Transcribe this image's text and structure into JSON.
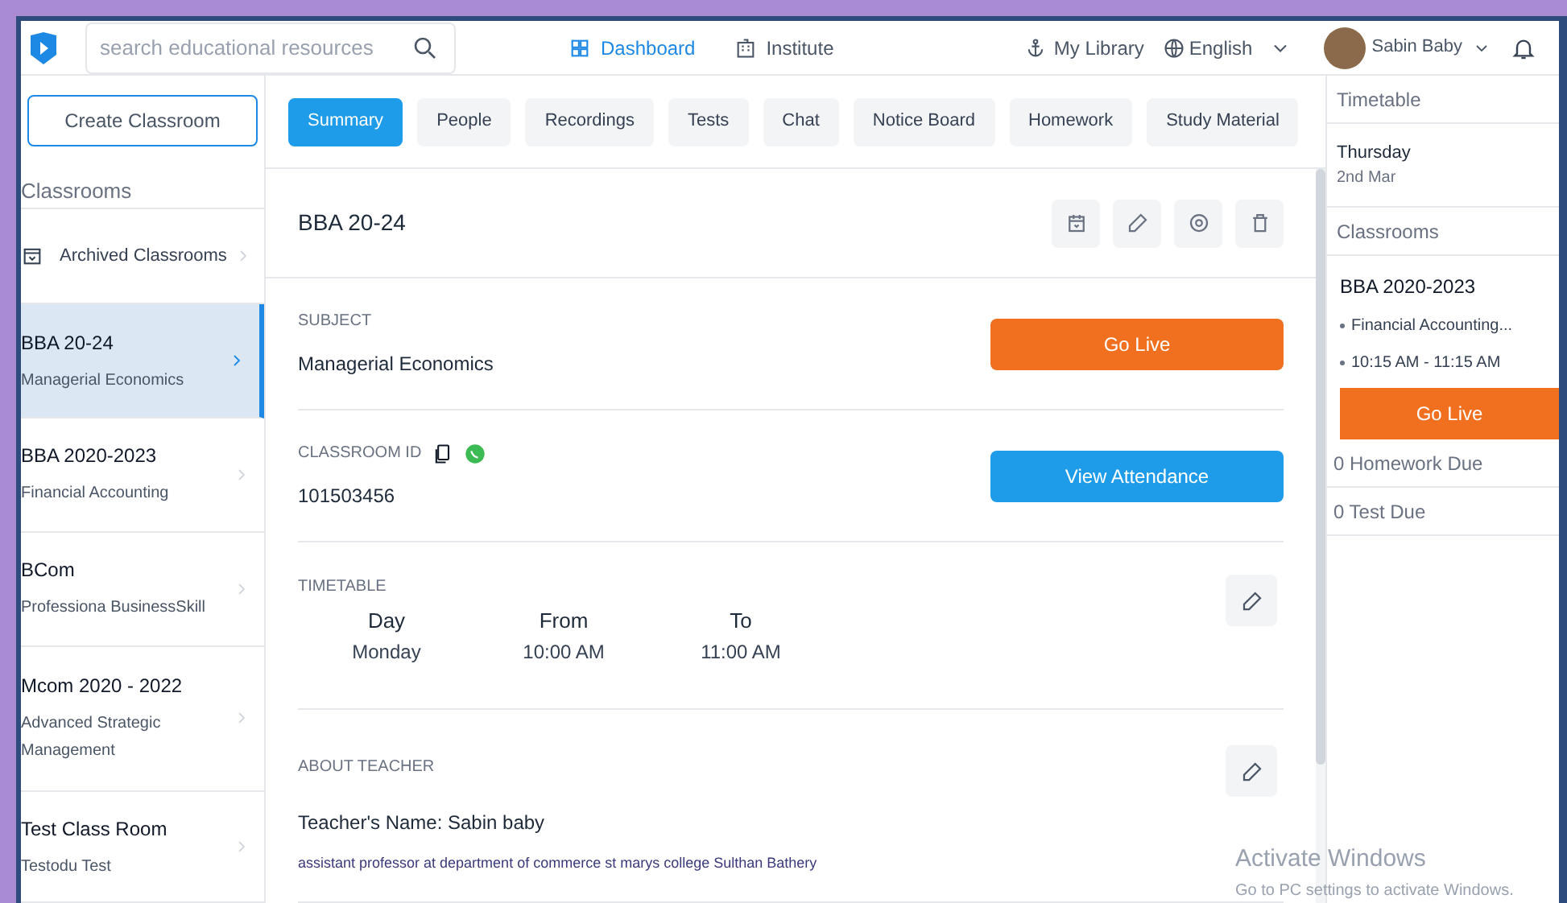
{
  "header": {
    "search": {
      "placeholder": "search educational resources"
    },
    "nav": [
      {
        "label": "Dashboard",
        "selected": true
      },
      {
        "label": "Institute",
        "selected": false
      }
    ],
    "my_library": "My Library",
    "language": "English",
    "user": "Sabin Baby"
  },
  "sidebar": {
    "create_button": "Create Classroom",
    "heading": "Classrooms",
    "archived": "Archived Classrooms",
    "items": [
      {
        "title": "BBA 20-24",
        "subtitle": "Managerial Economics",
        "selected": true
      },
      {
        "title": "BBA 2020-2023",
        "subtitle": "Financial Accounting",
        "selected": false
      },
      {
        "title": "BCom",
        "subtitle": "Professiona BusinessSkill",
        "selected": false
      },
      {
        "title": "Mcom 2020 - 2022",
        "subtitle": "Advanced Strategic Management",
        "selected": false
      },
      {
        "title": "Test Class Room",
        "subtitle": "Testodu Test",
        "selected": false
      }
    ]
  },
  "tabs": [
    {
      "label": "Summary",
      "selected": true
    },
    {
      "label": "People",
      "selected": false
    },
    {
      "label": "Recordings",
      "selected": false
    },
    {
      "label": "Tests",
      "selected": false
    },
    {
      "label": "Chat",
      "selected": false
    },
    {
      "label": "Notice Board",
      "selected": false
    },
    {
      "label": "Homework",
      "selected": false
    },
    {
      "label": "Study Material",
      "selected": false
    }
  ],
  "classroom": {
    "title": "BBA 20-24",
    "subject_label": "SUBJECT",
    "subject": "Managerial Economics",
    "go_live": "Go Live",
    "id_label": "CLASSROOM ID",
    "id": "101503456",
    "attendance": "View Attendance",
    "timetable_label": "TIMETABLE",
    "timetable_columns": [
      "Day",
      "From",
      "To"
    ],
    "timetable_row": [
      "Monday",
      "10:00 AM",
      "11:00 AM"
    ],
    "teacher_label": "ABOUT TEACHER",
    "teacher_name": "Teacher's Name: Sabin baby",
    "teacher_bio": "assistant professor at department of commerce st marys college Sulthan Bathery"
  },
  "right_panel": {
    "timetable_heading": "Timetable",
    "day": "Thursday",
    "date": "2nd Mar",
    "classrooms_heading": "Classrooms",
    "class_title": "BBA 2020-2023",
    "class_points": [
      "Financial Accounting...",
      "10:15 AM - 11:15 AM"
    ],
    "go_live": "Go Live",
    "homework_due": "0 Homework Due",
    "test_due": "0 Test Due"
  },
  "activation_notice": {
    "title": "Activate Windows",
    "message": "Go to PC settings to activate Windows."
  }
}
